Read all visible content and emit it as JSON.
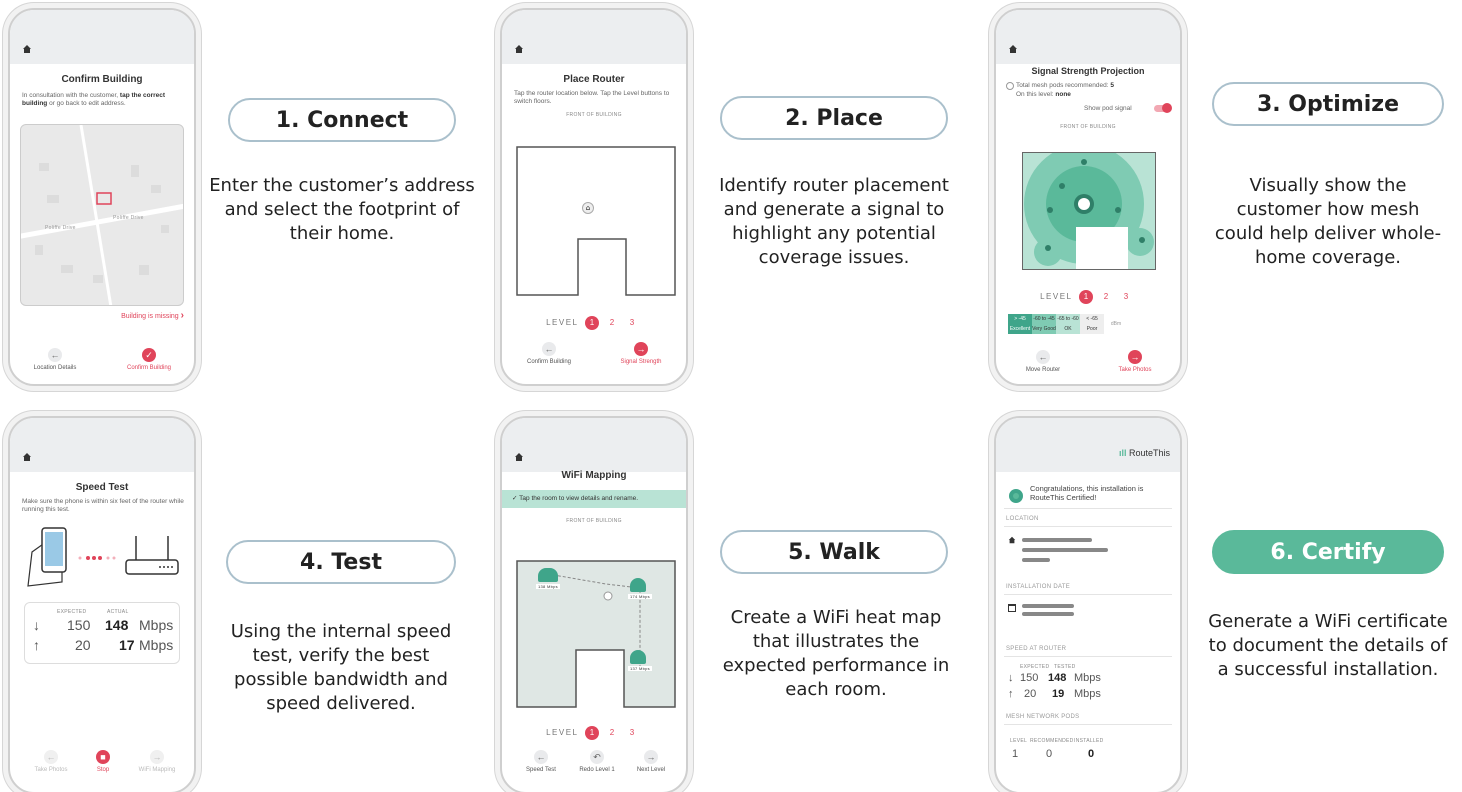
{
  "steps": [
    {
      "label": "1. Connect",
      "desc": "Enter the customer’s address and select the footprint of their home."
    },
    {
      "label": "2. Place",
      "desc": "Identify router placement and generate a signal to highlight any potential coverage issues."
    },
    {
      "label": "3. Optimize",
      "desc": "Visually show the customer how mesh could help deliver whole-home coverage."
    },
    {
      "label": "4. Test",
      "desc": "Using the internal speed test, verify the best possible bandwidth and speed delivered."
    },
    {
      "label": "5. Walk",
      "desc": "Create a WiFi heat map that illustrates the expected performance in each room."
    },
    {
      "label": "6. Certify",
      "desc": "Generate a WiFi certificate to document the details of a successful installation."
    }
  ],
  "screen1": {
    "title": "Confirm Building",
    "instr_a": "In consultation with the customer, ",
    "instr_b": "tap the correct building",
    "instr_c": " or go back to edit address.",
    "street1": "Poliffe Drive",
    "street2": "Poliffe Drive",
    "missing": "Building is missing",
    "back": "Location Details",
    "next": "Confirm Building"
  },
  "screen2": {
    "title": "Place Router",
    "instr": "Tap the router location below. Tap the Level buttons to switch floors.",
    "front": "FRONT OF BUILDING",
    "level": "LEVEL",
    "levels": [
      "1",
      "2",
      "3"
    ],
    "back": "Confirm Building",
    "next": "Signal Strength"
  },
  "screen3": {
    "title": "Signal Strength Projection",
    "pods_label": "Total mesh pods recommended: ",
    "pods_value": "5",
    "level_label": "On this level: ",
    "level_value": "none",
    "toggle": "Show pod signal",
    "front": "FRONT OF BUILDING",
    "level": "LEVEL",
    "levels": [
      "1",
      "2",
      "3"
    ],
    "legend": [
      {
        "range": "> -45",
        "label": "Excellent",
        "color": "#3fa58a"
      },
      {
        "range": "-60 to -45",
        "label": "Very Good",
        "color": "#7fcbb3"
      },
      {
        "range": "-65 to -60",
        "label": "OK",
        "color": "#b9e3d5"
      },
      {
        "range": "< -65",
        "label": "Poor",
        "color": "#eeeeee"
      }
    ],
    "unit": "dBm",
    "back": "Move Router",
    "next": "Take Photos"
  },
  "screen4": {
    "title": "Speed Test",
    "instr": "Make sure the phone is within six feet of the router while running this test.",
    "col_expected": "EXPECTED",
    "col_actual": "ACTUAL",
    "down_expected": "150",
    "down_actual": "148",
    "up_expected": "20",
    "up_actual": "17",
    "unit": "Mbps",
    "back": "Take Photos",
    "stop": "Stop",
    "next": "WiFi Mapping"
  },
  "screen5": {
    "title": "WiFi Mapping",
    "banner": "Tap the room to view details and rename.",
    "front": "FRONT OF BUILDING",
    "node1": "138 Mbps",
    "node2": "174 Mbps",
    "node3": "137 Mbps",
    "level": "LEVEL",
    "levels": [
      "1",
      "2",
      "3"
    ],
    "back": "Speed Test",
    "redo": "Redo Level 1",
    "next": "Next Level"
  },
  "screen6": {
    "brand": "RouteThis",
    "congrats": "Congratulations, this installation is RouteThis Certified!",
    "location": "LOCATION",
    "install_date": "INSTALLATION DATE",
    "speed_router": "SPEED AT ROUTER",
    "col_expected": "EXPECTED",
    "col_tested": "TESTED",
    "down_expected": "150",
    "down_tested": "148",
    "up_expected": "20",
    "up_tested": "19",
    "unit": "Mbps",
    "mesh_pods": "MESH NETWORK PODS",
    "col_level": "LEVEL",
    "col_recommended": "RECOMMENDED",
    "col_installed": "INSTALLED",
    "pod_level": "1",
    "pod_recommended": "0",
    "pod_installed": "0"
  },
  "colors": {
    "accent": "#e0445a",
    "teal": "#5ab99a",
    "pill_border": "#aac0cc"
  }
}
